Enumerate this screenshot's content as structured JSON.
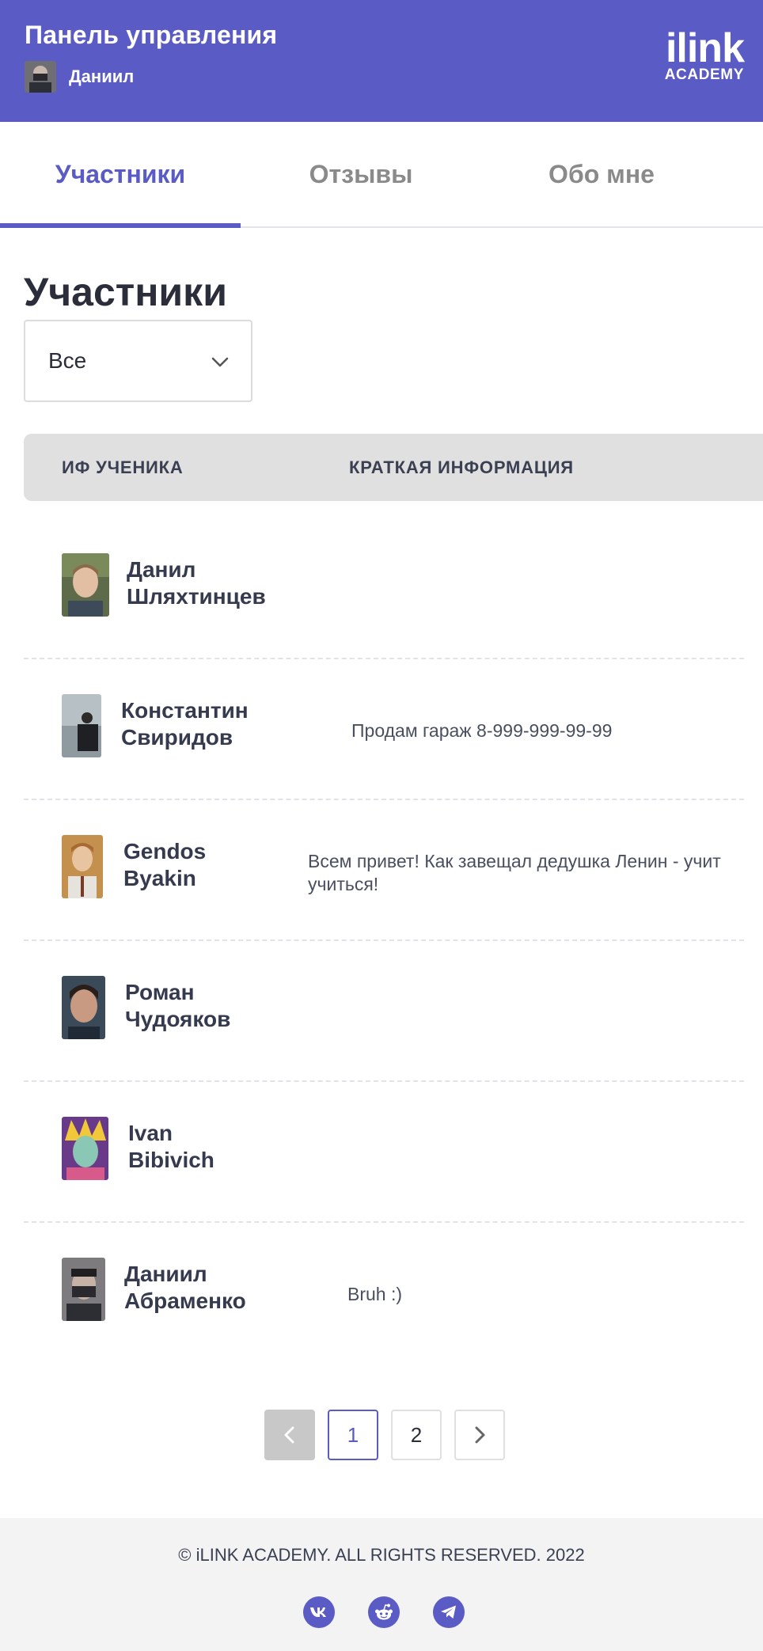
{
  "header": {
    "title": "Панель управления",
    "username": "Даниил",
    "logo_main": "ilink",
    "logo_sub": "ACADEMY"
  },
  "tabs": [
    {
      "label": "Участники",
      "active": true
    },
    {
      "label": "Отзывы",
      "active": false
    },
    {
      "label": "Обо мне",
      "active": false
    }
  ],
  "section_title": "Участники",
  "filter": {
    "selected": "Все",
    "icon": "chevron-down-icon"
  },
  "table": {
    "columns": [
      "ИФ УЧЕНИКА",
      "КРАТКАЯ ИНФОРМАЦИЯ"
    ],
    "rows": [
      {
        "name_line1": "Данил",
        "name_line2": "Шляхтинцев",
        "info_line1": "",
        "info_line2": ""
      },
      {
        "name_line1": "Константин",
        "name_line2": "Свиридов",
        "info_line1": "Продам гараж 8-999-999-99-99",
        "info_line2": ""
      },
      {
        "name_line1": "Gendos",
        "name_line2": "Byakin",
        "info_line1": "Всем привет! Как завещал дедушка Ленин - учит",
        "info_line2": "учиться!"
      },
      {
        "name_line1": "Роман",
        "name_line2": "Чудояков",
        "info_line1": "",
        "info_line2": ""
      },
      {
        "name_line1": "Ivan",
        "name_line2": "Bibivich",
        "info_line1": "",
        "info_line2": ""
      },
      {
        "name_line1": "Даниил",
        "name_line2": "Абраменко",
        "info_line1": "Bruh :)",
        "info_line2": ""
      }
    ]
  },
  "pagination": {
    "pages": [
      "1",
      "2"
    ],
    "current": "1",
    "prev_icon": "chevron-left-icon",
    "next_icon": "chevron-right-icon"
  },
  "footer": {
    "copyright": "© iLINK ACADEMY. ALL RIGHTS RESERVED. 2022",
    "socials": [
      "vk-icon",
      "reddit-icon",
      "telegram-icon"
    ]
  },
  "colors": {
    "accent": "#5a5bc4",
    "header_bg": "#5a5bc4",
    "table_head_bg": "#e0e0e0",
    "footer_bg": "#f3f3f3"
  }
}
